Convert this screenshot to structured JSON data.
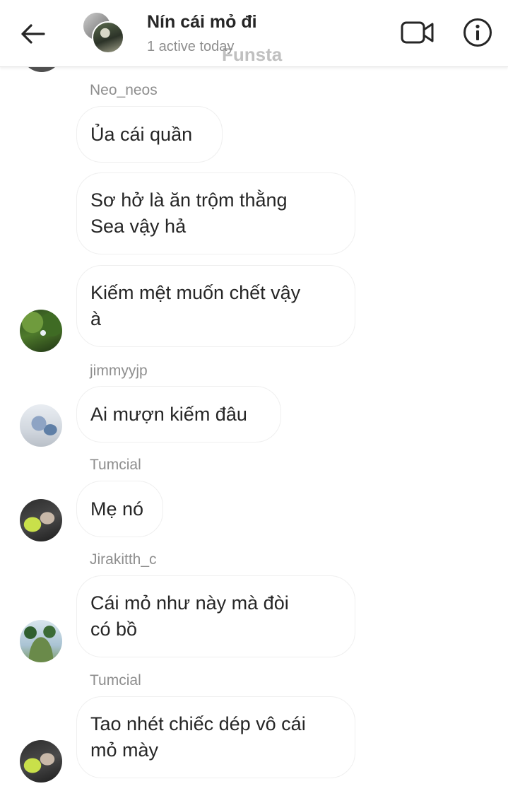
{
  "header": {
    "title": "Nín cái mỏ đi",
    "status": "1 active today",
    "watermark": "Funsta"
  },
  "messages": [
    {
      "sender": "Neo_neos",
      "bubbles": [
        "Ủa cái quần",
        [
          "Sơ hở là ăn trộm thằng",
          "Sea vậy hả"
        ],
        [
          "Kiếm mệt muốn chết vậy",
          "à"
        ]
      ]
    },
    {
      "sender": "jimmyyjp",
      "bubbles": [
        "Ai mượn kiếm đâu"
      ]
    },
    {
      "sender": "Tumcial",
      "bubbles": [
        "Mẹ nó"
      ]
    },
    {
      "sender": "Jirakitth_c",
      "bubbles": [
        [
          "Cái mỏ như này mà đòi",
          "có bồ"
        ]
      ]
    },
    {
      "sender": "Tumcial",
      "bubbles": [
        [
          "Tao nhét chiếc dép vô cái",
          "mỏ mày"
        ]
      ]
    }
  ]
}
